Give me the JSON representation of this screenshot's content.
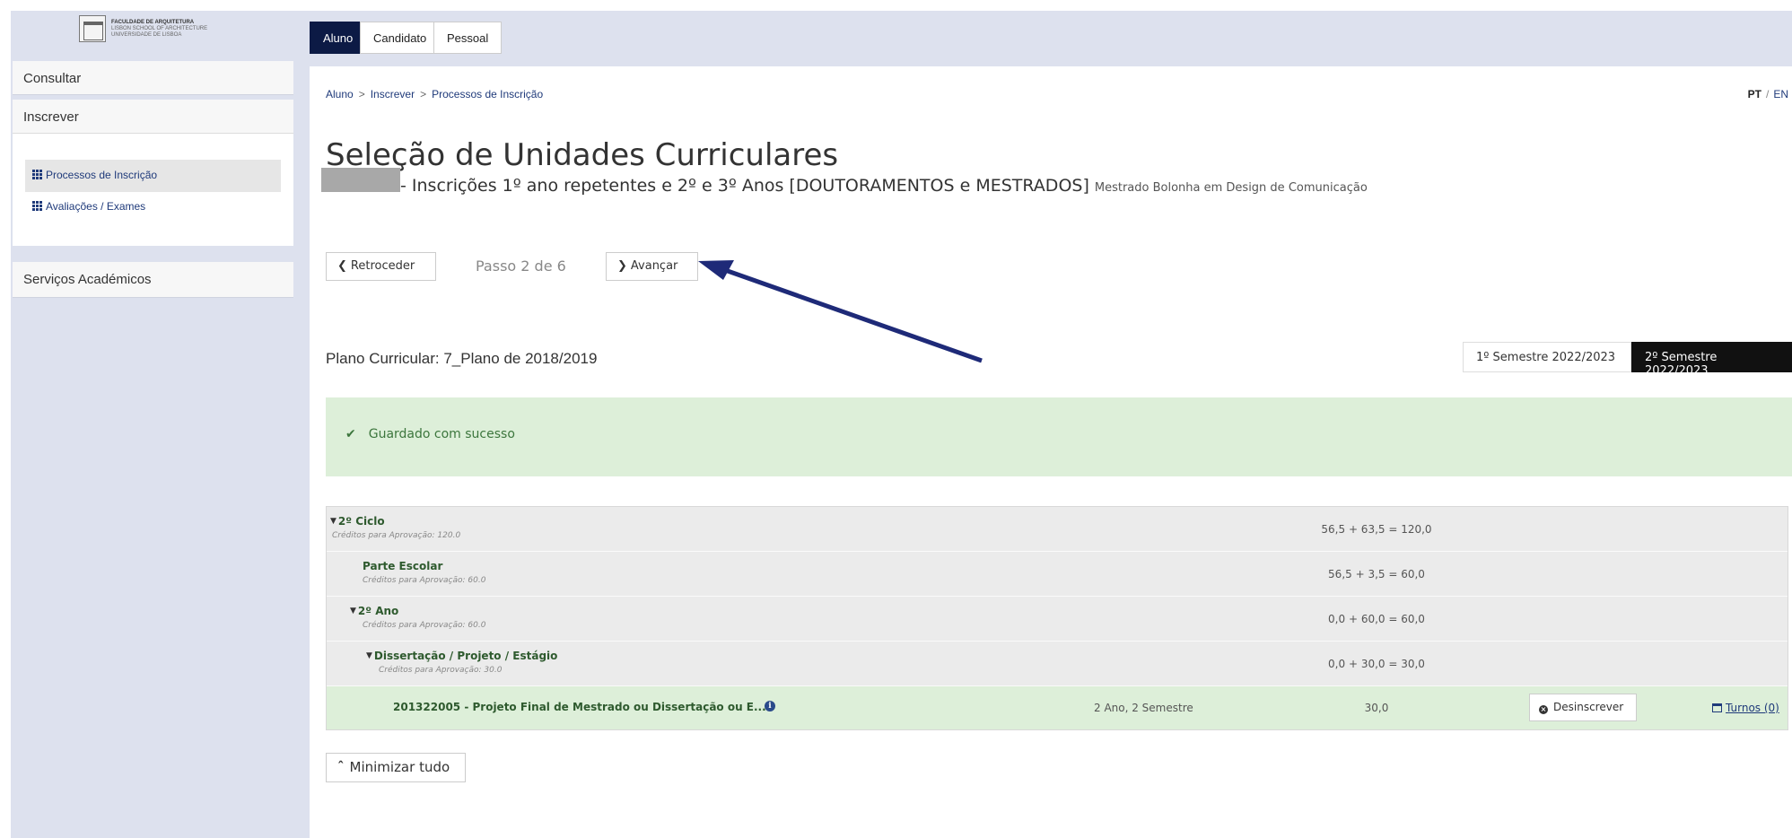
{
  "logo": {
    "line1": "FACULDADE DE ARQUITETURA",
    "line2": "LISBON SCHOOL OF ARCHITECTURE",
    "line3": "UNIVERSIDADE DE LISBOA"
  },
  "sidebar": {
    "consultar": "Consultar",
    "inscrever": "Inscrever",
    "items": [
      {
        "label": "Processos de Inscrição",
        "icon": "grid-icon",
        "active": true
      },
      {
        "label": "Avaliações / Exames",
        "icon": "grid-icon",
        "active": false
      }
    ],
    "servicos": "Serviços Académicos"
  },
  "tabs": [
    "Aluno",
    "Candidato",
    "Pessoal"
  ],
  "breadcrumb": [
    "Aluno",
    "Inscrever",
    "Processos de Inscrição"
  ],
  "breadcrumb_sep": ">",
  "lang": {
    "pt": "PT",
    "sep": "/",
    "en": "EN"
  },
  "page": {
    "title": "Seleção de Unidades Curriculares",
    "subtitle": "- Inscrições 1º ano repetentes e 2º e 3º Anos [DOUTORAMENTOS e MESTRADOS]",
    "course": "Mestrado Bolonha em Design de Comunicação"
  },
  "steps": {
    "back": "Retroceder",
    "indicator": "Passo 2 de 6",
    "next": "Avançar"
  },
  "plano": "Plano Curricular: 7_Plano de 2018/2019",
  "semesters": [
    "1º Semestre 2022/2023",
    "2º Semestre 2022/2023"
  ],
  "alert": "Guardado com sucesso",
  "tree": [
    {
      "name": "2º Ciclo",
      "sub": "Créditos para Aprovação: 120.0",
      "credits": "56,5 + 63,5 = 120,0",
      "caret": true
    },
    {
      "name": "Parte Escolar",
      "sub": "Créditos para Aprovação: 60.0",
      "credits": "56,5 + 3,5 = 60,0",
      "caret": false
    },
    {
      "name": "2º Ano",
      "sub": "Créditos para Aprovação: 60.0",
      "credits": "0,0 + 60,0 = 60,0",
      "caret": true
    },
    {
      "name": "Dissertação / Projeto / Estágio",
      "sub": "Créditos para Aprovação: 30.0",
      "credits": "0,0 + 30,0 = 30,0",
      "caret": true
    }
  ],
  "uc": {
    "name": "201322005 - Projeto Final de Mestrado ou Dissertação ou E...",
    "year": "2 Ano, 2 Semestre",
    "ects": "30,0",
    "unenroll": "Desinscrever",
    "turnos": "Turnos (0)"
  },
  "minimize": "Minimizar tudo",
  "colors": {
    "navy": "#0c1a45",
    "sidebar_bg": "#dde1ee",
    "success_bg": "#ddefd9",
    "arrow": "#1e2a78"
  }
}
